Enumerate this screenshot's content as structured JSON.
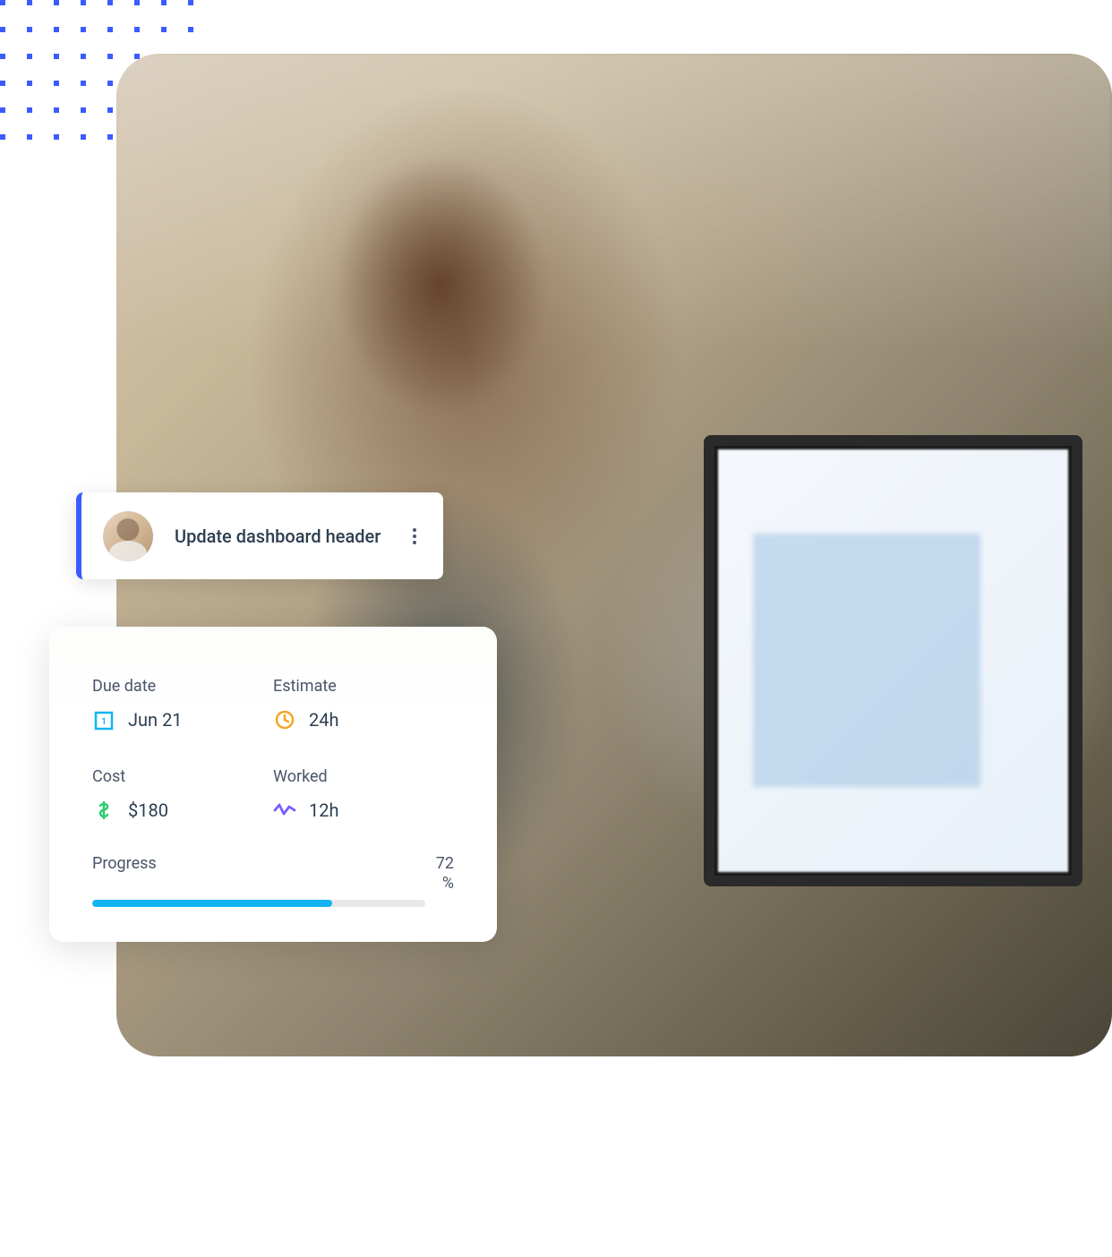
{
  "task": {
    "title": "Update dashboard header"
  },
  "details": {
    "due_date": {
      "label": "Due date",
      "value": "Jun 21"
    },
    "estimate": {
      "label": "Estimate",
      "value": "24h"
    },
    "cost": {
      "label": "Cost",
      "value": "$180"
    },
    "worked": {
      "label": "Worked",
      "value": "12h"
    },
    "progress": {
      "label": "Progress",
      "percent_value": "72",
      "percent_symbol": "%",
      "percent_fill": 72
    }
  },
  "colors": {
    "accent_blue": "#3b5bff",
    "icon_calendar": "#14b4f0",
    "icon_clock": "#f5a623",
    "icon_dollar": "#2ecc71",
    "icon_activity": "#7b5cff",
    "progress_bar": "#14b4f0"
  }
}
